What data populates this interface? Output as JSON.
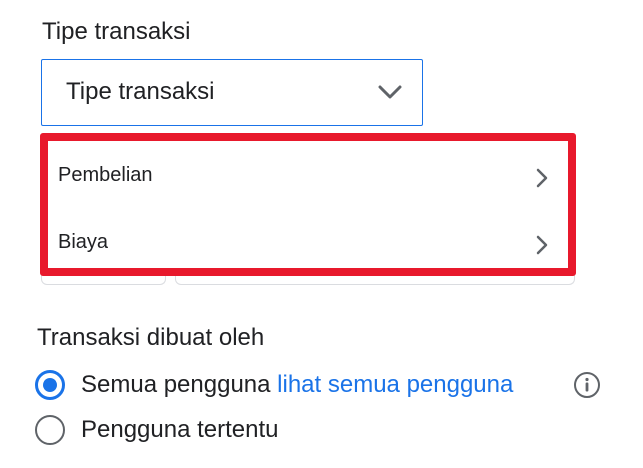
{
  "transaction_type": {
    "section_label": "Tipe transaksi",
    "select_value": "Tipe transaksi",
    "menu_items": [
      {
        "label": "Pembelian",
        "icon": "chevron-right-icon"
      },
      {
        "label": "Biaya",
        "icon": "chevron-right-icon"
      }
    ]
  },
  "created_by": {
    "section_label": "Transaksi dibuat oleh",
    "options": [
      {
        "label": "Semua pengguna",
        "link": "lihat semua pengguna",
        "checked": true,
        "icon": "info-icon"
      },
      {
        "label": "Pengguna tertentu",
        "checked": false
      }
    ]
  },
  "colors": {
    "accent": "#1a73e8",
    "highlight": "#e8192c",
    "text": "#202124"
  }
}
